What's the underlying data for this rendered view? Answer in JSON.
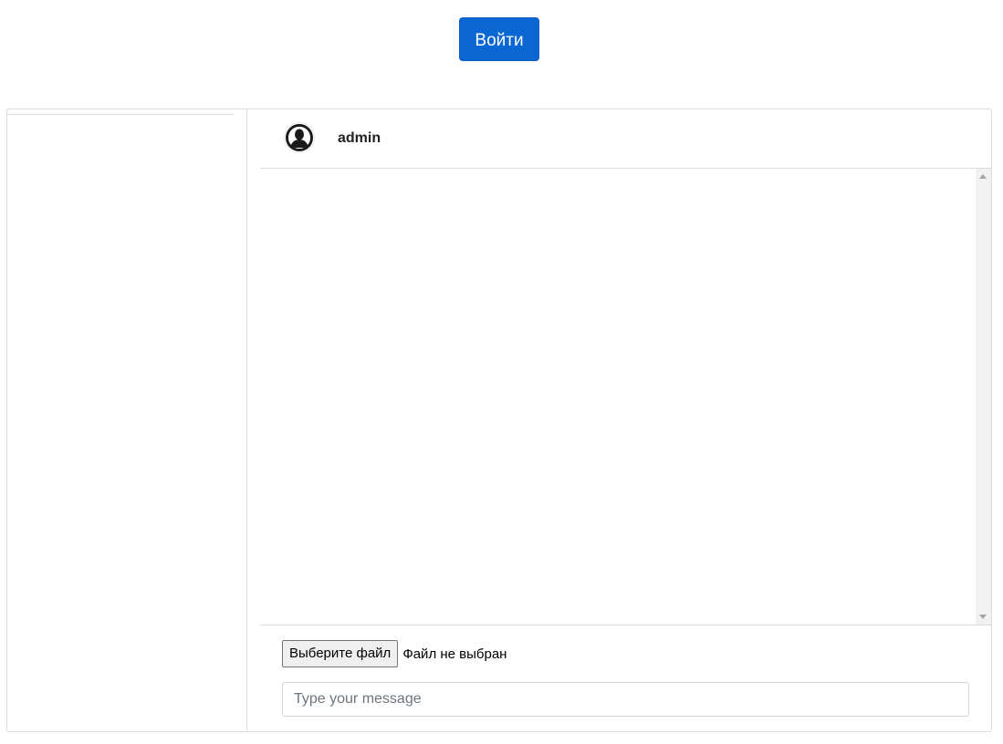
{
  "header": {
    "login_label": "Войти"
  },
  "chat": {
    "contact_name": "admin",
    "avatar_icon": "user-silhouette-icon",
    "file_picker": {
      "button_label": "Выберите файл",
      "status": "Файл не выбран"
    },
    "message_input": {
      "placeholder": "Type your message",
      "value": ""
    }
  },
  "colors": {
    "primary": "#0a66d2",
    "border": "#dcdcdc"
  }
}
